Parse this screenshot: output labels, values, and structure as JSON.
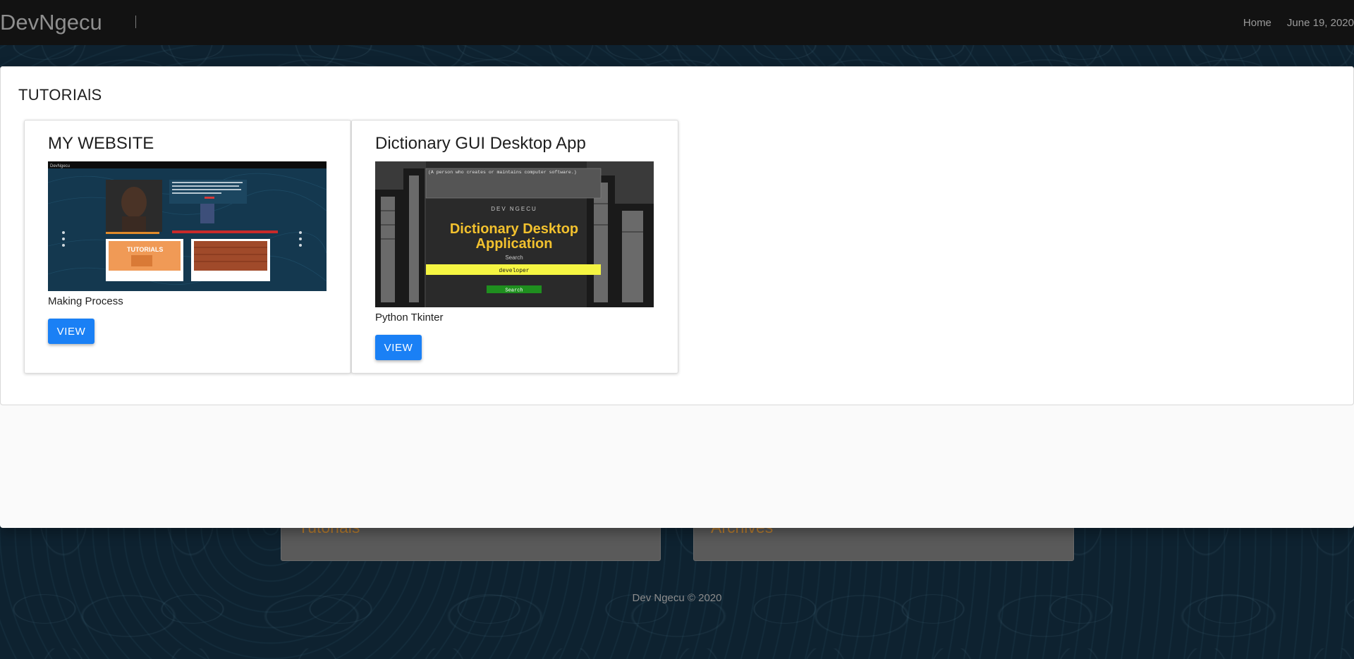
{
  "navbar": {
    "brand": "DevNgecu",
    "links": {
      "home": "Home",
      "date": "June 19, 2020"
    }
  },
  "section": {
    "title": "TUTORIAlS"
  },
  "cards": [
    {
      "title": "MY WEBSITE",
      "subtitle": "Making Process",
      "button": "VIEW",
      "thumb": {
        "brand": "DevNgecu",
        "banner": "TUTORIALS"
      }
    },
    {
      "title": "Dictionary GUI Desktop App",
      "subtitle": "Python Tkinter",
      "button": "VIEW",
      "thumb": {
        "top_text": "(A person who creates or maintains computer software.)",
        "caption": "DEV NGECU",
        "headline_1": "Dictionary Desktop",
        "headline_2": "Application",
        "search_label": "Search",
        "input_value": "developer",
        "button": "Search"
      }
    }
  ],
  "background": {
    "card_left": "Tutorials",
    "card_right": "Archives",
    "footer": "Dev Ngecu © 2020"
  },
  "colors": {
    "navbar_bg": "#121212",
    "button_blue": "#1a80f5",
    "accent_orange": "#b87c2e",
    "headline_yellow": "#f2c12e"
  }
}
